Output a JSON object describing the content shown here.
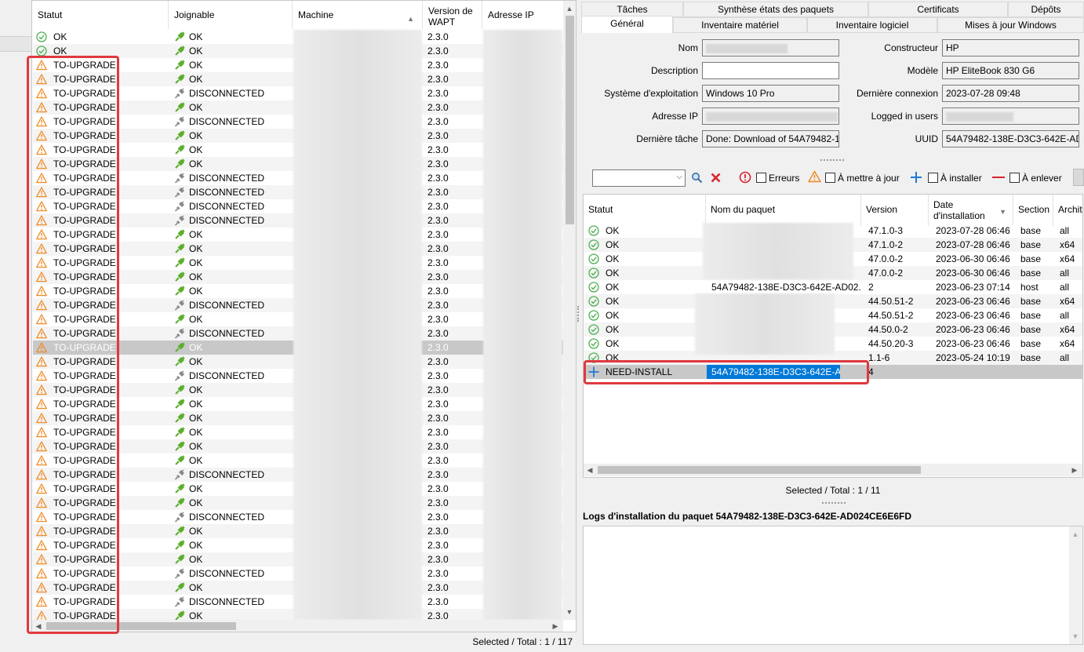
{
  "left": {
    "headers": {
      "statut": "Statut",
      "joignable": "Joignable",
      "machine": "Machine",
      "version": "Version de WAPT",
      "ip": "Adresse IP"
    },
    "rows": [
      {
        "statut": "OK",
        "joignable": "OK",
        "version": "2.3.0"
      },
      {
        "statut": "OK",
        "joignable": "OK",
        "version": "2.3.0"
      },
      {
        "statut": "TO-UPGRADE",
        "joignable": "OK",
        "version": "2.3.0"
      },
      {
        "statut": "TO-UPGRADE",
        "joignable": "OK",
        "version": "2.3.0"
      },
      {
        "statut": "TO-UPGRADE",
        "joignable": "DISCONNECTED",
        "version": "2.3.0"
      },
      {
        "statut": "TO-UPGRADE",
        "joignable": "OK",
        "version": "2.3.0"
      },
      {
        "statut": "TO-UPGRADE",
        "joignable": "DISCONNECTED",
        "version": "2.3.0"
      },
      {
        "statut": "TO-UPGRADE",
        "joignable": "OK",
        "version": "2.3.0"
      },
      {
        "statut": "TO-UPGRADE",
        "joignable": "OK",
        "version": "2.3.0"
      },
      {
        "statut": "TO-UPGRADE",
        "joignable": "OK",
        "version": "2.3.0"
      },
      {
        "statut": "TO-UPGRADE",
        "joignable": "DISCONNECTED",
        "version": "2.3.0"
      },
      {
        "statut": "TO-UPGRADE",
        "joignable": "DISCONNECTED",
        "version": "2.3.0"
      },
      {
        "statut": "TO-UPGRADE",
        "joignable": "DISCONNECTED",
        "version": "2.3.0"
      },
      {
        "statut": "TO-UPGRADE",
        "joignable": "DISCONNECTED",
        "version": "2.3.0"
      },
      {
        "statut": "TO-UPGRADE",
        "joignable": "OK",
        "version": "2.3.0"
      },
      {
        "statut": "TO-UPGRADE",
        "joignable": "OK",
        "version": "2.3.0"
      },
      {
        "statut": "TO-UPGRADE",
        "joignable": "OK",
        "version": "2.3.0"
      },
      {
        "statut": "TO-UPGRADE",
        "joignable": "OK",
        "version": "2.3.0"
      },
      {
        "statut": "TO-UPGRADE",
        "joignable": "OK",
        "version": "2.3.0"
      },
      {
        "statut": "TO-UPGRADE",
        "joignable": "DISCONNECTED",
        "version": "2.3.0"
      },
      {
        "statut": "TO-UPGRADE",
        "joignable": "OK",
        "version": "2.3.0"
      },
      {
        "statut": "TO-UPGRADE",
        "joignable": "DISCONNECTED",
        "version": "2.3.0"
      },
      {
        "statut": "TO-UPGRADE",
        "joignable": "OK",
        "version": "2.3.0",
        "selected": true
      },
      {
        "statut": "TO-UPGRADE",
        "joignable": "OK",
        "version": "2.3.0"
      },
      {
        "statut": "TO-UPGRADE",
        "joignable": "DISCONNECTED",
        "version": "2.3.0"
      },
      {
        "statut": "TO-UPGRADE",
        "joignable": "OK",
        "version": "2.3.0"
      },
      {
        "statut": "TO-UPGRADE",
        "joignable": "OK",
        "version": "2.3.0"
      },
      {
        "statut": "TO-UPGRADE",
        "joignable": "OK",
        "version": "2.3.0"
      },
      {
        "statut": "TO-UPGRADE",
        "joignable": "OK",
        "version": "2.3.0"
      },
      {
        "statut": "TO-UPGRADE",
        "joignable": "OK",
        "version": "2.3.0"
      },
      {
        "statut": "TO-UPGRADE",
        "joignable": "OK",
        "version": "2.3.0"
      },
      {
        "statut": "TO-UPGRADE",
        "joignable": "DISCONNECTED",
        "version": "2.3.0"
      },
      {
        "statut": "TO-UPGRADE",
        "joignable": "OK",
        "version": "2.3.0"
      },
      {
        "statut": "TO-UPGRADE",
        "joignable": "OK",
        "version": "2.3.0"
      },
      {
        "statut": "TO-UPGRADE",
        "joignable": "DISCONNECTED",
        "version": "2.3.0"
      },
      {
        "statut": "TO-UPGRADE",
        "joignable": "OK",
        "version": "2.3.0"
      },
      {
        "statut": "TO-UPGRADE",
        "joignable": "OK",
        "version": "2.3.0"
      },
      {
        "statut": "TO-UPGRADE",
        "joignable": "OK",
        "version": "2.3.0"
      },
      {
        "statut": "TO-UPGRADE",
        "joignable": "DISCONNECTED",
        "version": "2.3.0"
      },
      {
        "statut": "TO-UPGRADE",
        "joignable": "OK",
        "version": "2.3.0"
      },
      {
        "statut": "TO-UPGRADE",
        "joignable": "DISCONNECTED",
        "version": "2.3.0"
      },
      {
        "statut": "TO-UPGRADE",
        "joignable": "OK",
        "version": "2.3.0"
      }
    ],
    "footer": "Selected / Total : 1 / 117"
  },
  "tabs": {
    "row1": [
      "Tâches",
      "Synthèse états des paquets",
      "Certificats",
      "Dépôts"
    ],
    "row2": [
      "Général",
      "Inventaire matériel",
      "Inventaire logiciel",
      "Mises à jour Windows"
    ]
  },
  "general": {
    "nom_label": "Nom",
    "description_label": "Description",
    "os_label": "Système d'exploitation",
    "os_value": "Windows 10 Pro",
    "ip_label": "Adresse IP",
    "task_label": "Dernière tâche",
    "task_value": "Done: Download of 54A79482-1:",
    "constructeur_label": "Constructeur",
    "constructeur_value": "HP",
    "modele_label": "Modèle",
    "modele_value": "HP EliteBook 830 G6",
    "connexion_label": "Dernière connexion",
    "connexion_value": "2023-07-28 09:48",
    "logged_label": "Logged in users",
    "uuid_label": "UUID",
    "uuid_value": "54A79482-138E-D3C3-642E-AD0"
  },
  "filters": {
    "erreurs": "Erreurs",
    "a_mettre_a_jour": "À mettre à jour",
    "a_installer": "À installer",
    "a_enlever": "À enlever"
  },
  "packages": {
    "headers": {
      "statut": "Statut",
      "nom": "Nom du paquet",
      "version": "Version",
      "date": "Date d'installation",
      "section": "Section",
      "archi": "Archit"
    },
    "rows": [
      {
        "statut": "OK",
        "nom": "",
        "version": "47.1.0-3",
        "date": "2023-07-28 06:46",
        "section": "base",
        "archi": "all"
      },
      {
        "statut": "OK",
        "nom": "",
        "version": "47.1.0-2",
        "date": "2023-07-28 06:46",
        "section": "base",
        "archi": "x64"
      },
      {
        "statut": "OK",
        "nom": "",
        "version": "47.0.0-2",
        "date": "2023-06-30 06:46",
        "section": "base",
        "archi": "x64"
      },
      {
        "statut": "OK",
        "nom": "",
        "version": "47.0.0-2",
        "date": "2023-06-30 06:46",
        "section": "base",
        "archi": "all"
      },
      {
        "statut": "OK",
        "nom": "54A79482-138E-D3C3-642E-AD02...",
        "version": "2",
        "date": "2023-06-23 07:14",
        "section": "host",
        "archi": "all"
      },
      {
        "statut": "OK",
        "nom": "",
        "version": "44.50.51-2",
        "date": "2023-06-23 06:46",
        "section": "base",
        "archi": "x64"
      },
      {
        "statut": "OK",
        "nom": "",
        "version": "44.50.51-2",
        "date": "2023-06-23 06:46",
        "section": "base",
        "archi": "all"
      },
      {
        "statut": "OK",
        "nom": "",
        "version": "44.50.0-2",
        "date": "2023-06-23 06:46",
        "section": "base",
        "archi": "x64"
      },
      {
        "statut": "OK",
        "nom": "",
        "version": "44.50.20-3",
        "date": "2023-06-23 06:46",
        "section": "base",
        "archi": "x64"
      },
      {
        "statut": "OK",
        "nom": "",
        "version": "1.1-6",
        "date": "2023-05-24 10:19",
        "section": "base",
        "archi": "all"
      },
      {
        "statut": "NEED-INSTALL",
        "nom": "54A79482-138E-D3C3-642E-AD02...",
        "version": "4",
        "date": "",
        "section": "",
        "archi": "",
        "selected": true
      }
    ],
    "footer": "Selected / Total : 1 / 11"
  },
  "logs_title": "Logs d'installation du paquet 54A79482-138E-D3C3-642E-AD024CE6E6FD",
  "colors": {
    "ok_green": "#4caf50",
    "warn_orange": "#f08a24",
    "plus_blue": "#1e7ad6",
    "highlight_red": "#e0393e",
    "select_blue": "#0078d7"
  }
}
